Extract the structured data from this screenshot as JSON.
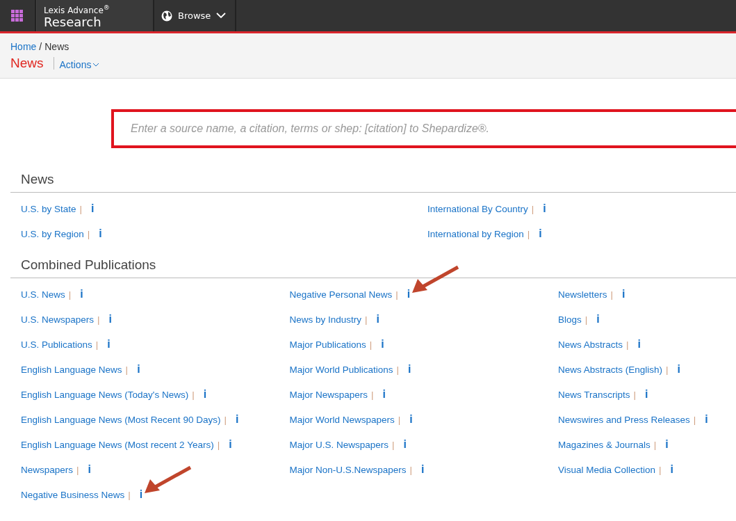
{
  "header": {
    "brand_top": "Lexis Advance",
    "brand_mark": "®",
    "brand_bottom": "Research",
    "browse": "Browse"
  },
  "breadcrumb": [
    {
      "label": "Home",
      "link": true
    },
    {
      "label": "/",
      "link": false
    },
    {
      "label": "News",
      "link": false
    }
  ],
  "page_title": "News",
  "actions": "Actions",
  "search": {
    "placeholder": "Enter a source name, a citation, terms or shep: [citation] to Shepardize®."
  },
  "sections": [
    {
      "title": "News",
      "columns": [
        [
          {
            "label": "U.S. by State",
            "separator": "|",
            "info": "i",
            "marked": false
          },
          {
            "label": "U.S. by Region",
            "separator": "|",
            "info": "i",
            "marked": false
          }
        ],
        [
          {
            "label": "International By Country",
            "separator": "|",
            "info": "i",
            "marked": false
          },
          {
            "label": "International by Region",
            "separator": "|",
            "info": "i",
            "marked": false
          }
        ]
      ]
    },
    {
      "title": "Combined Publications",
      "columns": [
        [
          {
            "label": "U.S. News",
            "separator": "|",
            "info": "i",
            "marked": false
          },
          {
            "label": "U.S. Newspapers",
            "separator": "|",
            "info": "i",
            "marked": false
          },
          {
            "label": "U.S. Publications",
            "separator": "|",
            "info": "i",
            "marked": false
          },
          {
            "label": "English Language News",
            "separator": "|",
            "info": "i",
            "marked": false
          },
          {
            "label": "English Language News (Today's News)",
            "separator": "|",
            "info": "i",
            "marked": false
          },
          {
            "label": "English Language News (Most Recent 90 Days)",
            "separator": "|",
            "info": "i",
            "marked": false
          },
          {
            "label": "English Language News (Most recent 2 Years)",
            "separator": "|",
            "info": "i",
            "marked": false
          },
          {
            "label": "Newspapers",
            "separator": "|",
            "info": "i",
            "marked": false
          },
          {
            "label": "Negative Business News",
            "separator": "|",
            "info": "i",
            "marked": true
          }
        ],
        [
          {
            "label": "Negative Personal News",
            "separator": "|",
            "info": "i",
            "marked": true
          },
          {
            "label": "News by Industry",
            "separator": "|",
            "info": "i",
            "marked": false
          },
          {
            "label": "Major Publications",
            "separator": "|",
            "info": "i",
            "marked": false
          },
          {
            "label": "Major World Publications",
            "separator": "|",
            "info": "i",
            "marked": false
          },
          {
            "label": "Major Newspapers",
            "separator": "|",
            "info": "i",
            "marked": false
          },
          {
            "label": "Major World Newspapers",
            "separator": "|",
            "info": "i",
            "marked": false
          },
          {
            "label": "Major U.S. Newspapers",
            "separator": "|",
            "info": "i",
            "marked": false
          },
          {
            "label": "Major Non-U.S.Newspapers",
            "separator": "|",
            "info": "i",
            "marked": false
          }
        ],
        [
          {
            "label": "Newsletters",
            "separator": "|",
            "info": "i",
            "marked": false
          },
          {
            "label": "Blogs",
            "separator": "|",
            "info": "i",
            "marked": false
          },
          {
            "label": "News Abstracts",
            "separator": "|",
            "info": "i",
            "marked": false
          },
          {
            "label": "News Abstracts (English)",
            "separator": "|",
            "info": "i",
            "marked": false
          },
          {
            "label": "News Transcripts",
            "separator": "|",
            "info": "i",
            "marked": false
          },
          {
            "label": "Newswires and Press Releases",
            "separator": "|",
            "info": "i",
            "marked": false
          },
          {
            "label": "Magazines & Journals",
            "separator": "|",
            "info": "i",
            "marked": false
          },
          {
            "label": "Visual Media Collection",
            "separator": "|",
            "info": "i",
            "marked": false
          }
        ]
      ]
    }
  ]
}
